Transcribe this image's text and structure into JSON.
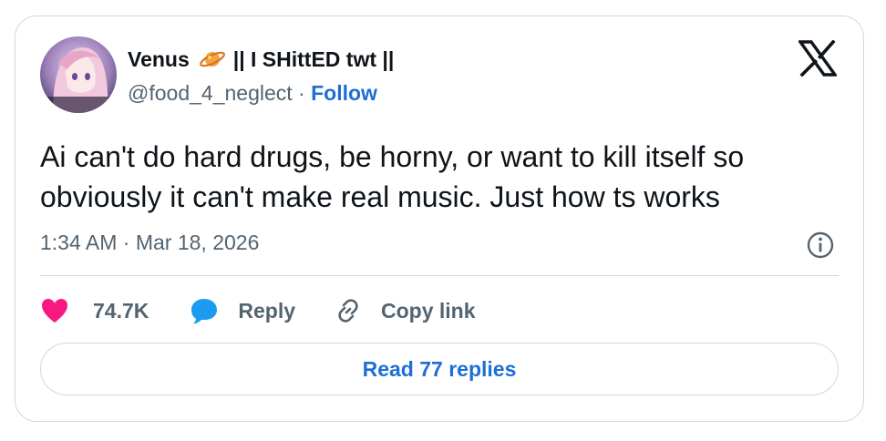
{
  "author": {
    "display_name": "Venus",
    "display_name_suffix": "|| I SHittED twt ||",
    "handle": "@food_4_neglect",
    "separator": "·",
    "follow_label": "Follow",
    "avatar_icon": "avatar-image",
    "name_emoji_icon": "ringed-planet-icon"
  },
  "platform_icon": "x-logo-icon",
  "tweet": {
    "text": "Ai can't do hard drugs, be horny, or want to kill itself so obviously it can't make real music. Just how ts works",
    "timestamp": "1:34 AM · Mar 18, 2026"
  },
  "actions": {
    "likes_count": "74.7K",
    "reply_label": "Reply",
    "copy_link_label": "Copy link"
  },
  "read_replies_label": "Read 77 replies",
  "colors": {
    "link_blue": "#1d6fd3",
    "heart_pink": "#f91880",
    "reply_blue": "#1d9bf0",
    "muted_text": "#536471",
    "border": "#cfd9de"
  }
}
